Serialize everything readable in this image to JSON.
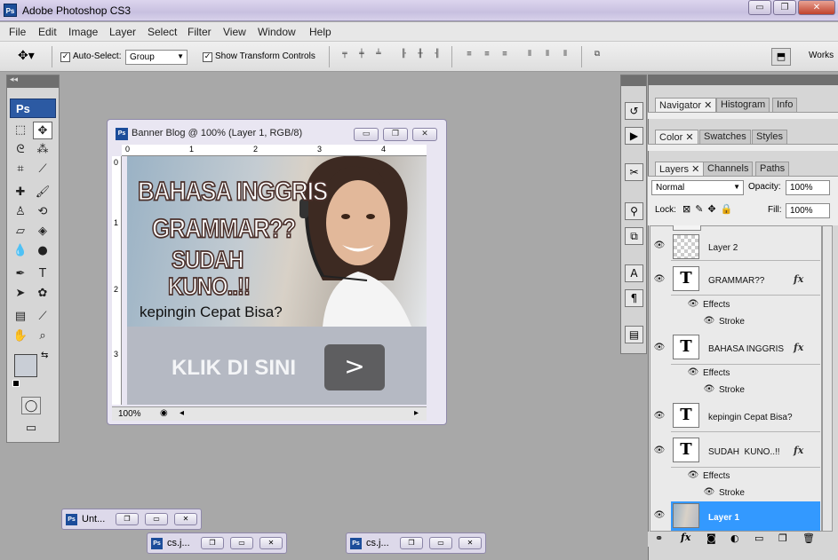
{
  "app": {
    "title": "Adobe Photoshop CS3",
    "logo": "Ps"
  },
  "window_controls": {
    "minimize": "▭",
    "restore": "❐",
    "close": "✕"
  },
  "menu": [
    "File",
    "Edit",
    "Image",
    "Layer",
    "Select",
    "Filter",
    "View",
    "Window",
    "Help"
  ],
  "options": {
    "auto_select_label": "Auto-Select:",
    "auto_select_checked": true,
    "auto_select_value": "Group",
    "show_transform_label": "Show Transform Controls",
    "show_transform_checked": true,
    "workspace_label": "Works"
  },
  "document": {
    "title": "Banner Blog @ 100% (Layer 1, RGB/8)",
    "zoom": "100%",
    "ruler_h": [
      "0",
      "1",
      "2",
      "3",
      "4"
    ],
    "ruler_v": [
      "0",
      "1",
      "2",
      "3"
    ],
    "banner": {
      "line1": "BAHASA INGGRIS",
      "line2": "GRAMMAR??",
      "line3": "SUDAH",
      "line4": "KUNO..!!",
      "line5": "kepingin Cepat Bisa?",
      "cta": "KLIK DI SINI",
      "cta_arrow": ">"
    }
  },
  "panels": {
    "group1_tabs": [
      "Navigator",
      "Histogram",
      "Info"
    ],
    "group2_tabs": [
      "Color",
      "Swatches",
      "Styles"
    ],
    "group3_tabs": [
      "Layers",
      "Channels",
      "Paths"
    ],
    "blend_mode": "Normal",
    "opacity_label": "Opacity:",
    "opacity_value": "100%",
    "lock_label": "Lock:",
    "fill_label": "Fill:",
    "fill_value": "100%"
  },
  "layers": [
    {
      "name": "Layer 2",
      "type": "raster",
      "fx": false
    },
    {
      "name": "GRAMMAR??",
      "type": "text",
      "fx": true,
      "effects": "Effects",
      "effect": "Stroke"
    },
    {
      "name": "BAHASA INGGRIS",
      "type": "text",
      "fx": true,
      "effects": "Effects",
      "effect": "Stroke"
    },
    {
      "name": "kepingin Cepat Bisa?",
      "type": "text",
      "fx": false
    },
    {
      "name": "SUDAH  KUNO..!!",
      "type": "text",
      "fx": true,
      "effects": "Effects",
      "effect": "Stroke"
    },
    {
      "name": "Layer 1",
      "type": "raster",
      "fx": false,
      "selected": true
    }
  ],
  "layer_thumb_text": "T",
  "fx_label": "fx",
  "minimized": [
    {
      "title": "Unt..."
    },
    {
      "title": "cs.j..."
    },
    {
      "title": "cs.j..."
    }
  ],
  "colors": {
    "accent": "#1c4d9a",
    "selected_layer": "#3399ff"
  }
}
